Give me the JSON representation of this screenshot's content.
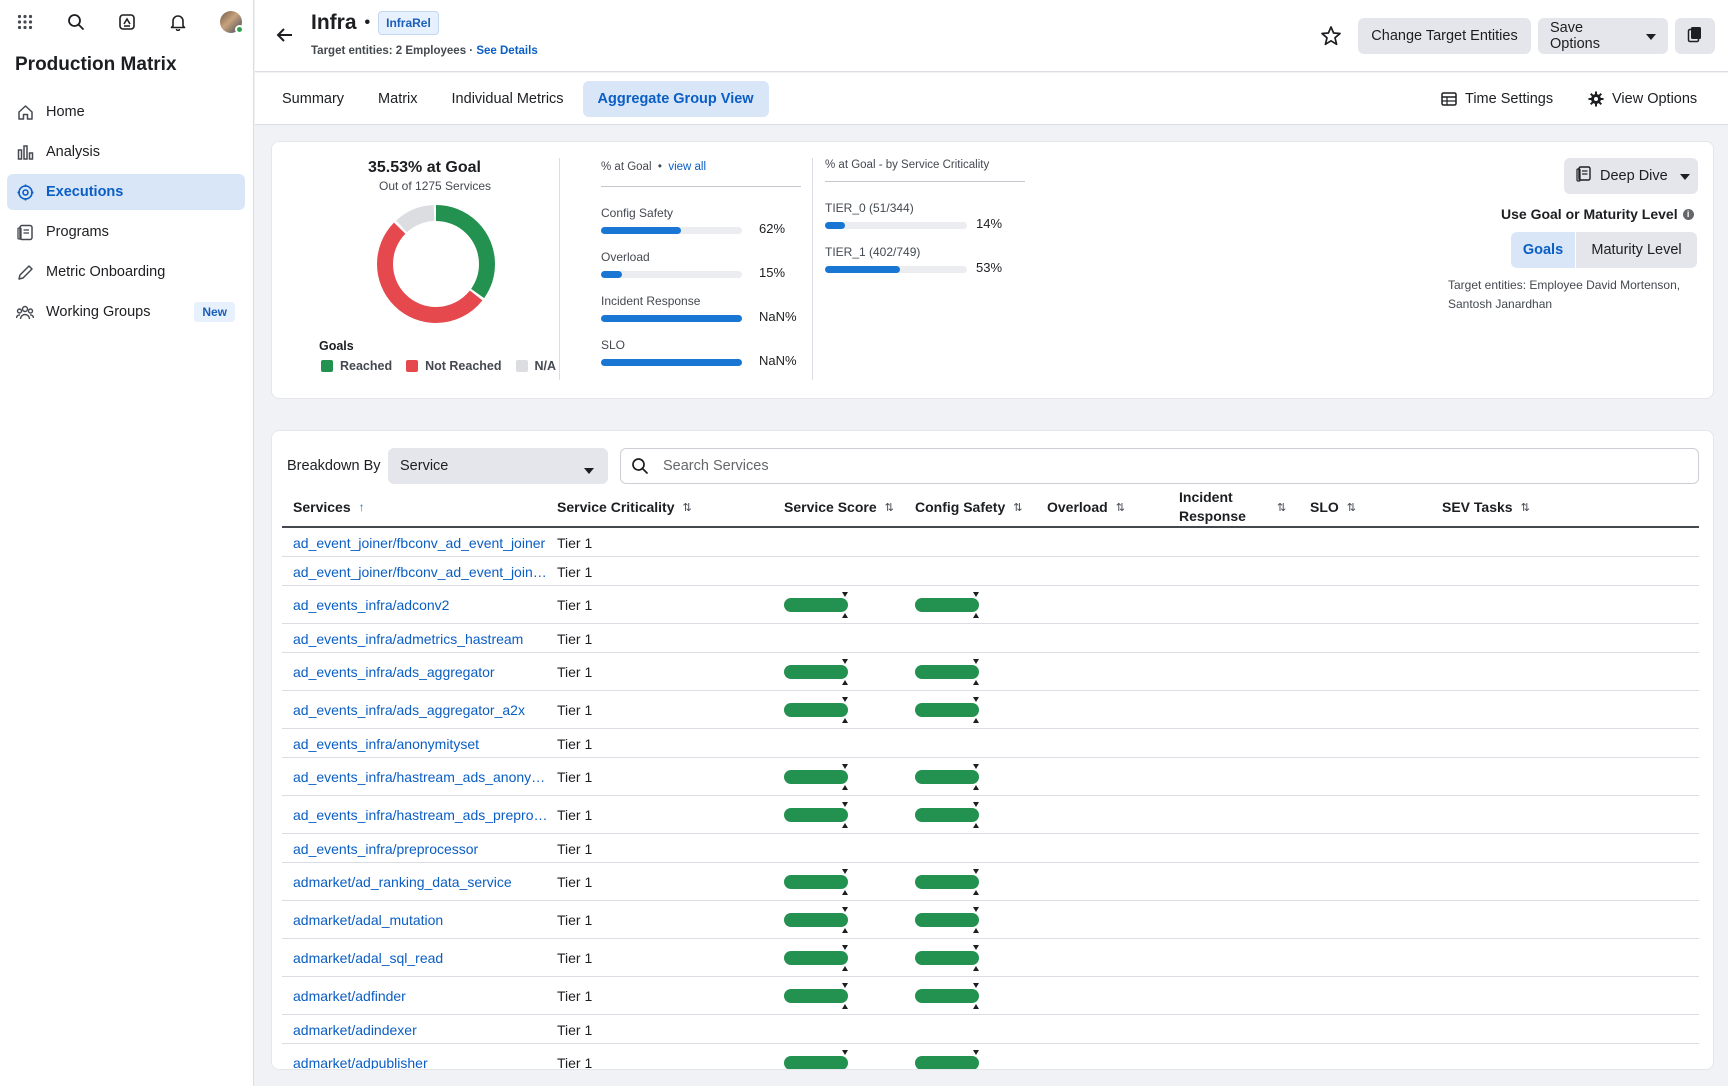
{
  "sidebar": {
    "app_title": "Production Matrix",
    "top_icons": [
      "apps-grid-icon",
      "search-icon",
      "calendar-icon",
      "bell-icon",
      "avatar"
    ],
    "items": [
      {
        "label": "Home",
        "icon": "home-icon",
        "active": false
      },
      {
        "label": "Analysis",
        "icon": "bar-chart-icon",
        "active": false
      },
      {
        "label": "Executions",
        "icon": "target-icon",
        "active": true
      },
      {
        "label": "Programs",
        "icon": "document-icon",
        "active": false
      },
      {
        "label": "Metric Onboarding",
        "icon": "pencil-icon",
        "active": false
      },
      {
        "label": "Working Groups",
        "icon": "people-icon",
        "active": false,
        "badge": "New"
      }
    ]
  },
  "header": {
    "title": "Infra",
    "tag": "InfraRel",
    "subtitle": "Target entities: 2 Employees",
    "separator": "·",
    "see_details": "See Details",
    "change_target": "Change Target Entities",
    "save_options": "Save Options"
  },
  "tabs": {
    "items": [
      "Summary",
      "Matrix",
      "Individual Metrics",
      "Aggregate Group View"
    ],
    "active_index": 3,
    "time_settings": "Time Settings",
    "view_options": "View Options"
  },
  "summary": {
    "title": "35.53% at Goal",
    "subtitle": "Out of 1275 Services",
    "donut": {
      "reached": 35.53,
      "not_reached": 52.5,
      "na": 11.97
    },
    "legend_title": "Goals",
    "legend": [
      {
        "label": "Reached",
        "color": "#23914f"
      },
      {
        "label": "Not Reached",
        "color": "#e5484d"
      },
      {
        "label": "N/A",
        "color": "#dcdde0"
      }
    ],
    "metrics_header": "% at Goal",
    "view_all": "view all",
    "metrics": [
      {
        "label": "Config Safety",
        "value": "62%",
        "fill": 0.57
      },
      {
        "label": "Overload",
        "value": "15%",
        "fill": 0.15
      },
      {
        "label": "Incident Response",
        "value": "NaN%",
        "fill": 1.0
      },
      {
        "label": "SLO",
        "value": "NaN%",
        "fill": 1.0
      }
    ],
    "criticality_header": "% at Goal - by Service Criticality",
    "criticality": [
      {
        "label": "TIER_0 (51/344)",
        "value": "14%",
        "fill": 0.14
      },
      {
        "label": "TIER_1 (402/749)",
        "value": "53%",
        "fill": 0.53
      }
    ],
    "deep_dive": "Deep Dive",
    "goal_question": "Use Goal or Maturity Level",
    "goals": "Goals",
    "maturity": "Maturity Level",
    "target_note": "Target entities: Employee David Mortenson, Santosh Janardhan"
  },
  "table": {
    "breakdown_label": "Breakdown By",
    "breakdown_value": "Service",
    "search_placeholder": "Search Services",
    "columns": [
      "Services",
      "Service Criticality",
      "Service Score",
      "Config Safety",
      "Overload",
      "Incident Response",
      "SLO",
      "SEV Tasks"
    ],
    "rows": [
      {
        "service": "ad_event_joiner/fbconv_ad_event_joiner",
        "criticality": "Tier 1",
        "bars": false
      },
      {
        "service": "ad_event_joiner/fbconv_ad_event_joiner_shadow",
        "criticality": "Tier 1",
        "bars": false
      },
      {
        "service": "ad_events_infra/adconv2",
        "criticality": "Tier 1",
        "bars": true
      },
      {
        "service": "ad_events_infra/admetrics_hastream",
        "criticality": "Tier 1",
        "bars": false
      },
      {
        "service": "ad_events_infra/ads_aggregator",
        "criticality": "Tier 1",
        "bars": true
      },
      {
        "service": "ad_events_infra/ads_aggregator_a2x",
        "criticality": "Tier 1",
        "bars": true
      },
      {
        "service": "ad_events_infra/anonymityset",
        "criticality": "Tier 1",
        "bars": false
      },
      {
        "service": "ad_events_infra/hastream_ads_anonymityset",
        "criticality": "Tier 1",
        "bars": true
      },
      {
        "service": "ad_events_infra/hastream_ads_preprocessor",
        "criticality": "Tier 1",
        "bars": true
      },
      {
        "service": "ad_events_infra/preprocessor",
        "criticality": "Tier 1",
        "bars": false
      },
      {
        "service": "admarket/ad_ranking_data_service",
        "criticality": "Tier 1",
        "bars": true
      },
      {
        "service": "admarket/adal_mutation",
        "criticality": "Tier 1",
        "bars": true
      },
      {
        "service": "admarket/adal_sql_read",
        "criticality": "Tier 1",
        "bars": true
      },
      {
        "service": "admarket/adfinder",
        "criticality": "Tier 1",
        "bars": true
      },
      {
        "service": "admarket/adindexer",
        "criticality": "Tier 1",
        "bars": false
      },
      {
        "service": "admarket/adpublisher",
        "criticality": "Tier 1",
        "bars": true
      }
    ]
  }
}
